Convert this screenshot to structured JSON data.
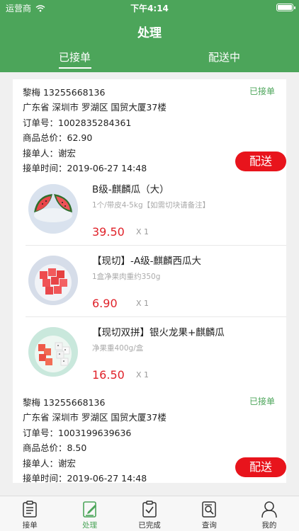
{
  "status_bar": {
    "carrier": "运营商",
    "time": "下午4:14",
    "battery_level": 1.0
  },
  "header": {
    "title": "处理"
  },
  "tabs": [
    {
      "label": "已接单",
      "active": true
    },
    {
      "label": "配送中",
      "active": false
    }
  ],
  "orders": [
    {
      "contact": "黎梅 13255668136",
      "status": "已接单",
      "address": "广东省 深圳市 罗湖区 国贸大厦37楼",
      "order_no": "订单号：1002835284361",
      "total": "商品总价：62.90",
      "receiver": "接单人：谢宏",
      "time": "接单时间：2019-06-27 14:48",
      "action": "配送",
      "products": [
        {
          "name": "B级-麒麟瓜（大）",
          "spec": "1个/带皮4-5kg【如需切块请备注】",
          "price": "39.50",
          "qty": "X 1",
          "image": "watermelon-halves"
        },
        {
          "name": "【现切】-A级-麒麟西瓜大",
          "spec": "1盒净果肉重约350g",
          "price": "6.90",
          "qty": "X 1",
          "image": "watermelon-cubes"
        },
        {
          "name": "【现切双拼】银火龙果+麒麟瓜",
          "spec": "净果重400g/盒",
          "price": "16.50",
          "qty": "X 1",
          "image": "dragonfruit-watermelon"
        }
      ]
    },
    {
      "contact": "黎梅 13255668136",
      "status": "已接单",
      "address": "广东省 深圳市 罗湖区 国贸大厦37楼",
      "order_no": "订单号：1003199639636",
      "total": "商品总价：8.50",
      "receiver": "接单人：谢宏",
      "time": "接单时间：2019-06-27 14:48",
      "action": "配送"
    }
  ],
  "tabbar": [
    {
      "label": "接单",
      "icon": "clipboard-icon",
      "active": false
    },
    {
      "label": "处理",
      "icon": "edit-icon",
      "active": true
    },
    {
      "label": "已完成",
      "icon": "check-clipboard-icon",
      "active": false
    },
    {
      "label": "查询",
      "icon": "search-document-icon",
      "active": false
    },
    {
      "label": "我的",
      "icon": "user-icon",
      "active": false
    }
  ],
  "colors": {
    "brand": "#4ca55a",
    "danger": "#e8141c",
    "price": "#e0222a"
  }
}
